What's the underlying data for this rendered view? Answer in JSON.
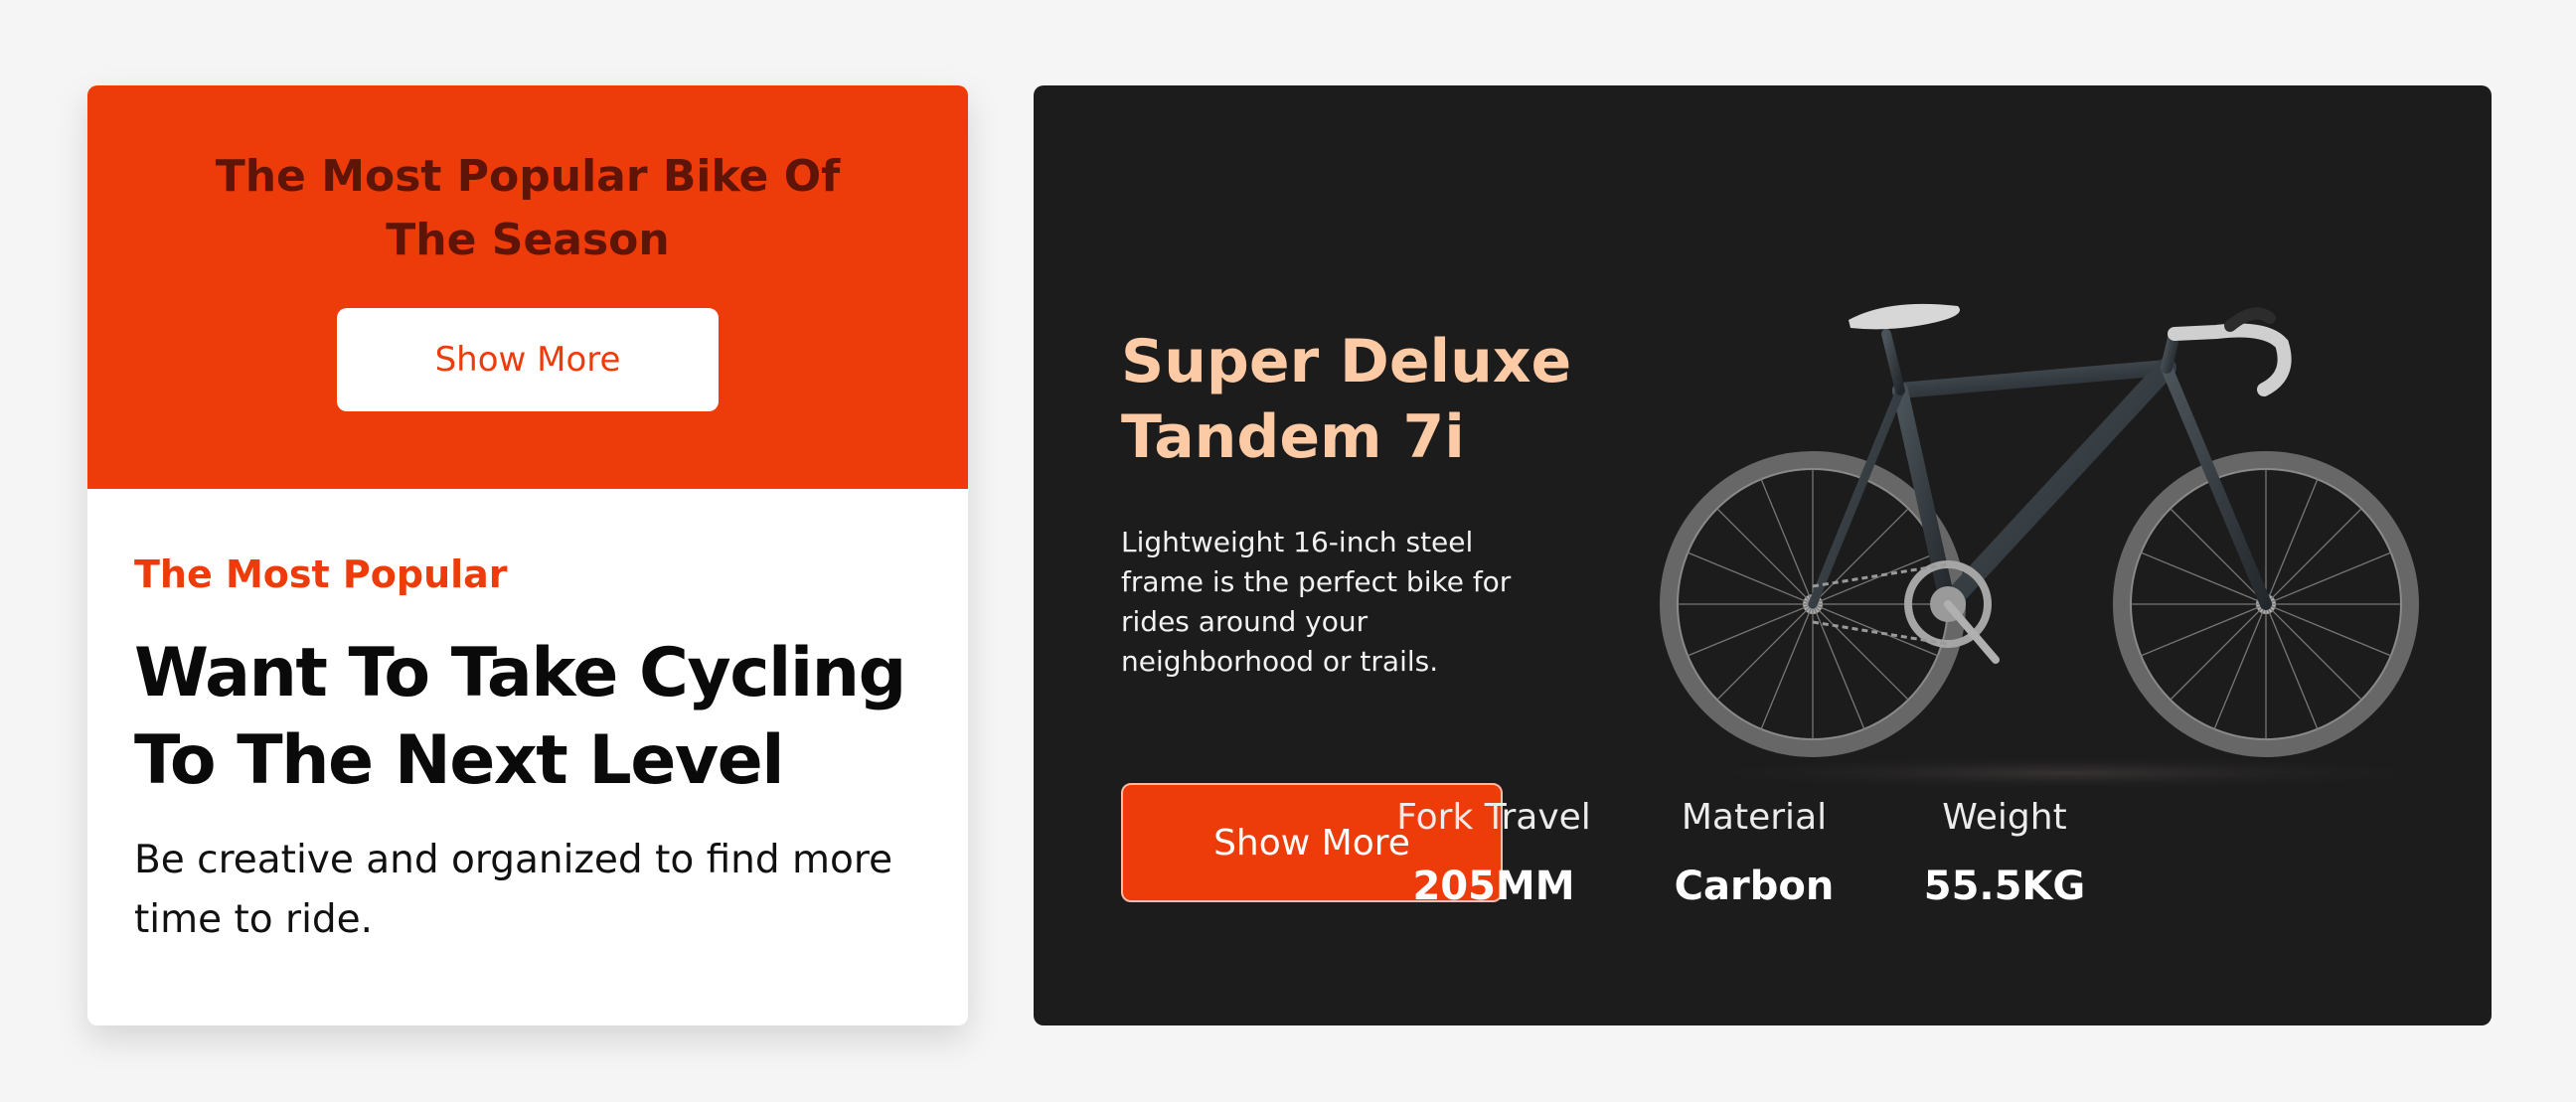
{
  "promo": {
    "heading": "The Most Popular Bike Of The Season",
    "button_label": "Show More",
    "eyebrow": "The Most Popular",
    "title": "Want To Take Cycling To The Next Level",
    "description": "Be creative and organized to find more time to ride."
  },
  "product": {
    "name": "Super Deluxe Tandem 7i",
    "description": "Lightweight 16-inch steel frame is the perfect bike for rides around your neighborhood or trails.",
    "button_label": "Show More",
    "image_icon": "road-bike-icon",
    "specs": [
      {
        "label": "Fork Travel",
        "value": "205MM"
      },
      {
        "label": "Material",
        "value": "Carbon"
      },
      {
        "label": "Weight",
        "value": "55.5KG"
      }
    ]
  },
  "colors": {
    "accent": "#ee3b0a",
    "heading_dark_red": "#5e1407",
    "product_title": "#fccaa4",
    "dark_card": "#1c1c1c",
    "page_background": "#f5f5f5"
  }
}
